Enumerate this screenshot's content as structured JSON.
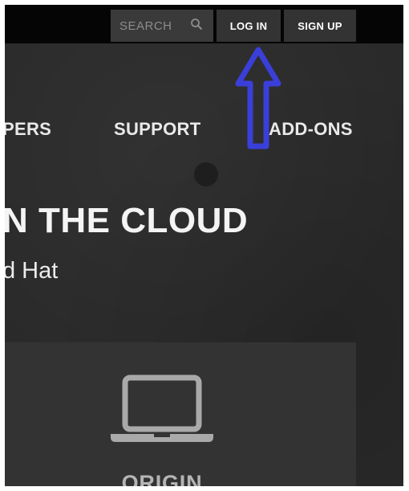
{
  "header": {
    "search": {
      "placeholder": "SEARCH",
      "icon": "search-icon"
    },
    "login_label": "LOG IN",
    "signup_label": "SIGN UP"
  },
  "nav": {
    "items": [
      {
        "label": "PERS"
      },
      {
        "label": "SUPPORT"
      },
      {
        "label": "ADD-ONS"
      }
    ]
  },
  "hero": {
    "title": "N THE CLOUD",
    "subtitle": "d Hat"
  },
  "card": {
    "icon": "laptop-icon",
    "label": "ORIGIN"
  },
  "annotation": {
    "icon": "up-arrow-icon",
    "color": "#3b3fd9"
  },
  "colors": {
    "background": "#2a2a2a",
    "topbar": "#050505",
    "button": "#333333",
    "accent_arrow": "#3b3fd9"
  }
}
